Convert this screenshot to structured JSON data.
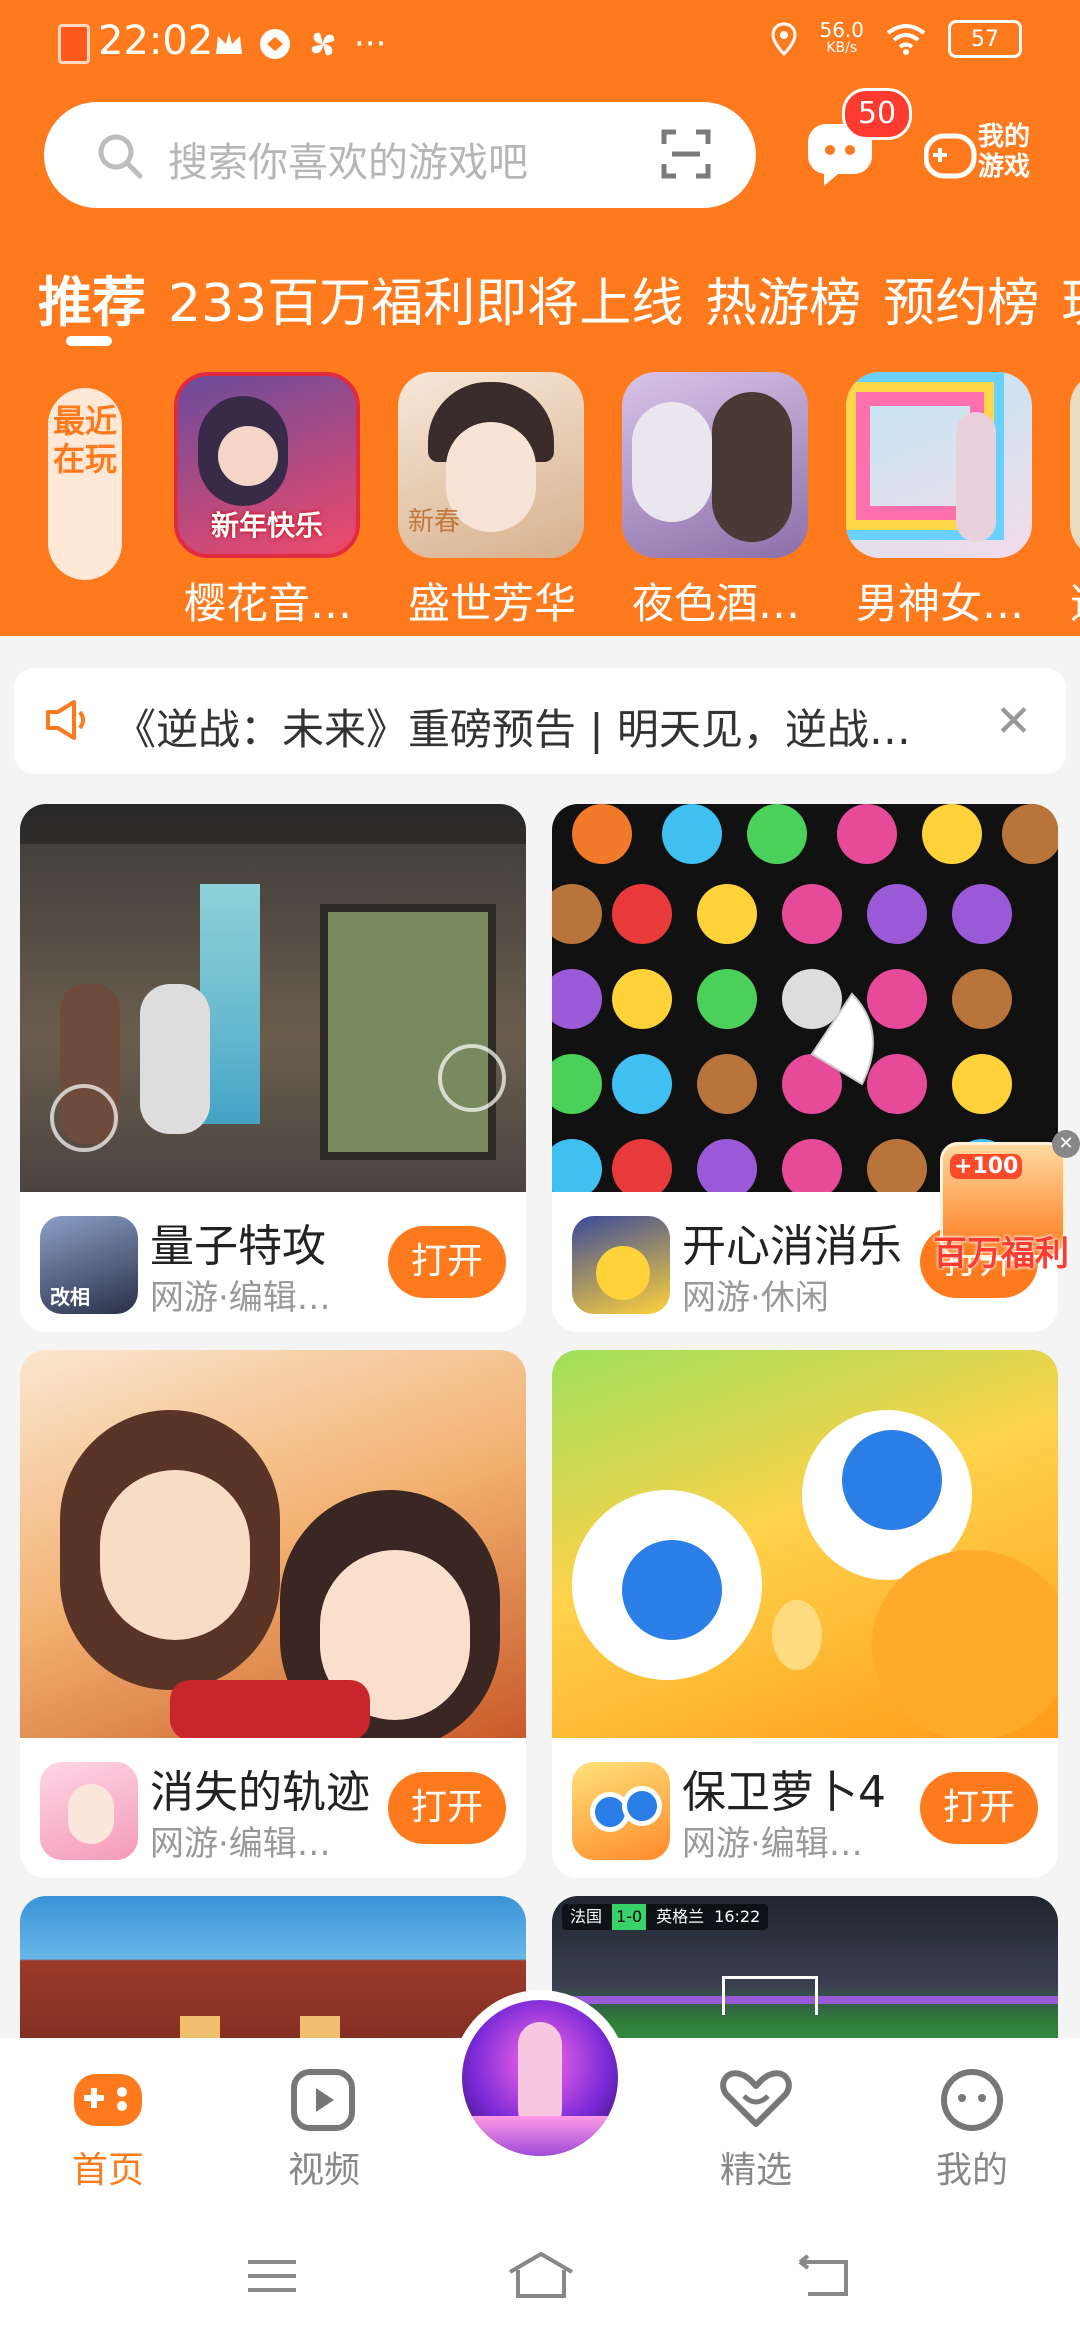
{
  "status_bar": {
    "time": "22:02",
    "net_speed": "56.0",
    "net_unit": "KB/s",
    "battery": "57"
  },
  "search": {
    "placeholder": "搜索你喜欢的游戏吧"
  },
  "header": {
    "message_badge": "50",
    "my_games_label": "我的游戏"
  },
  "tabs": [
    {
      "label": "推荐",
      "active": true
    },
    {
      "label": "233百万福利"
    },
    {
      "label": "即将上线"
    },
    {
      "label": "热游榜"
    },
    {
      "label": "预约榜"
    },
    {
      "label": "玩"
    }
  ],
  "recent": {
    "label": "最近在玩",
    "apps": [
      {
        "name": "樱花音…",
        "badge_text": "新年快乐",
        "color": "#f04a6a"
      },
      {
        "name": "盛世芳华",
        "badge_text": "新春",
        "color": "#e8c7a5"
      },
      {
        "name": "夜色酒…",
        "color": "#8c6fa8"
      },
      {
        "name": "男神女…",
        "color": "#a8d8ea"
      },
      {
        "name": "逆",
        "color": "#d9c59a"
      }
    ]
  },
  "notice": {
    "text": "《逆战：未来》重磅预告 | 明天见，逆战…"
  },
  "cards": [
    {
      "name": "量子特攻",
      "sub": "网游·编辑…",
      "action": "打开",
      "icon_label": "改相",
      "thumb_color": "#5a5550"
    },
    {
      "name": "开心消消乐",
      "sub": "网游·休闲",
      "action": "打开",
      "thumb_color": "#1a1a1a"
    },
    {
      "name": "消失的轨迹",
      "sub": "网游·编辑…",
      "action": "打开",
      "thumb_color": "#f2c9a0"
    },
    {
      "name": "保卫萝卜4",
      "sub": "网游·编辑…",
      "action": "打开",
      "thumb_color": "#ffd24a"
    },
    {
      "name": "",
      "sub": "",
      "action": "",
      "thumb_color": "#3a87c8"
    },
    {
      "name": "",
      "sub": "",
      "action": "",
      "thumb_color": "#2f3a4a"
    }
  ],
  "promo": {
    "label": "百万福利",
    "amount": "+100"
  },
  "football_score": {
    "home": "法国",
    "score": "1-0",
    "away": "英格兰",
    "time": "16:22"
  },
  "bottom_nav": [
    {
      "label": "首页",
      "active": true,
      "icon": "gamepad-icon"
    },
    {
      "label": "视频",
      "icon": "video-icon"
    },
    {
      "label": "",
      "icon": "featured-game-icon"
    },
    {
      "label": "精选",
      "icon": "heart-icon"
    },
    {
      "label": "我的",
      "icon": "profile-icon"
    }
  ],
  "colors": {
    "brand": "#ff7a1c",
    "badge": "#ff3b2f"
  }
}
